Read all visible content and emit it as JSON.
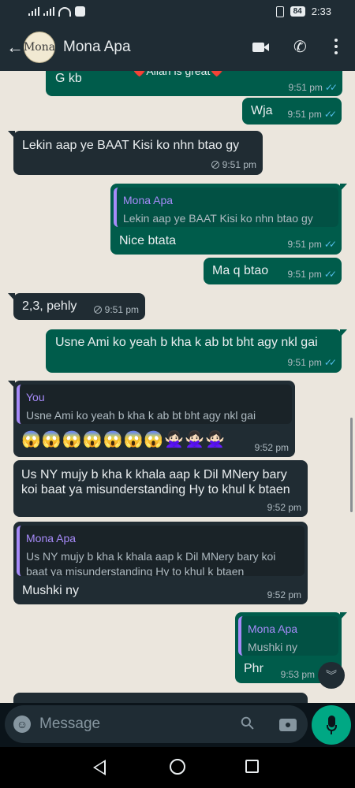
{
  "status_bar": {
    "time": "2:33",
    "battery": "84"
  },
  "header": {
    "contact_name": "Mona Apa",
    "avatar_text": "Mona"
  },
  "messages": [
    {
      "text": "G kb",
      "extra": "❤️Allah is great❤️",
      "time": "9:51 pm"
    },
    {
      "text": "Wja",
      "time": "9:51 pm"
    },
    {
      "text": "Lekin aap ye BAAT Kisi ko nhn btao gy",
      "time": "9:51 pm"
    },
    {
      "quote_name": "Mona Apa",
      "quote_text": "Lekin aap ye BAAT Kisi ko nhn btao gy",
      "text": "Nice btata",
      "time": "9:51 pm"
    },
    {
      "text": "Ma q btao",
      "time": "9:51 pm"
    },
    {
      "text": "2,3, pehly",
      "time": "9:51 pm"
    },
    {
      "text": "Usne Ami ko yeah b kha k ab bt bht agy nkl gai",
      "time": "9:51 pm"
    },
    {
      "quote_name": "You",
      "quote_text": "Usne Ami ko yeah b kha k ab bt bht agy nkl gai",
      "text": "😱😱😱😱😱😱😱🙅🏻‍♀️🙅🏻‍♀️🙅🏻‍♀️",
      "time": "9:52 pm"
    },
    {
      "text": "Us NY mujy b kha k khala aap k Dil MNery bary koi baat ya misunderstanding Hy to khul k btaen",
      "time": "9:52 pm"
    },
    {
      "quote_name": "Mona Apa",
      "quote_text": "Us NY mujy b kha k khala aap k Dil MNery bary koi baat ya misunderstanding Hy to khul k btaen",
      "text": "Mushki ny",
      "time": "9:52 pm"
    },
    {
      "quote_name": "Mona Apa",
      "quote_text": "Mushki ny",
      "text": "Phr",
      "time": "9:53 pm"
    }
  ],
  "input": {
    "placeholder": "Message"
  }
}
